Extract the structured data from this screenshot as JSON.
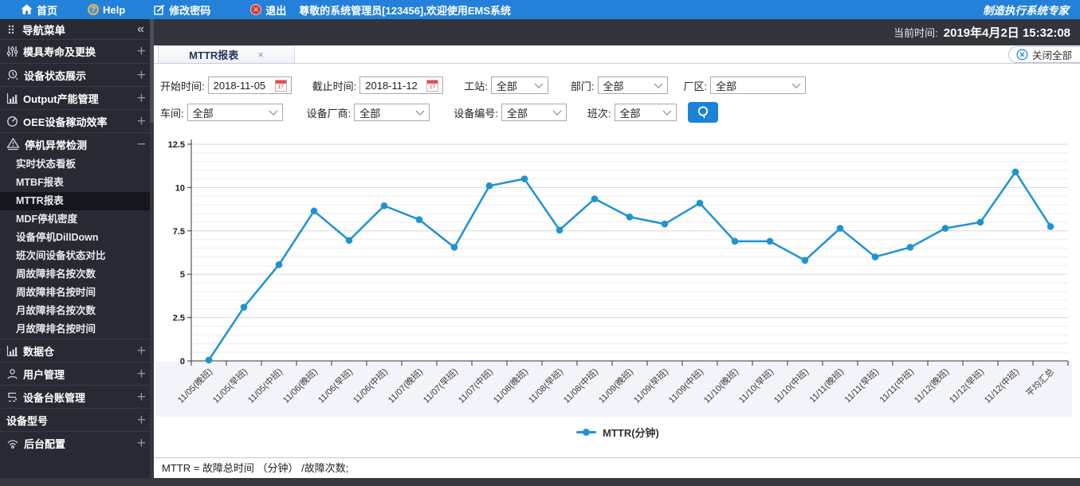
{
  "topbar": {
    "home": "首页",
    "help": "Help",
    "help_mark": "?",
    "change_password": "修改密码",
    "logout": "退出",
    "logout_mark": "✕",
    "welcome": "尊敬的系统管理员[123456],欢迎使用EMS系统",
    "brand": "制造执行系统专家"
  },
  "infobar": {
    "current_time_label": "当前时间:",
    "current_time_value": "2019年4月2日 15:32:08"
  },
  "tabs": {
    "active": "MTTR报表",
    "close_icon": "×",
    "close_all": "关闭全部"
  },
  "sidebar": {
    "title": "导航菜单",
    "collapse_icon": "«",
    "groups": [
      {
        "label": "模具寿命及更换",
        "icon": "sliders-icon",
        "state": "collapsed"
      },
      {
        "label": "设备状态展示",
        "icon": "status-icon",
        "state": "collapsed"
      },
      {
        "label": "Output产能管理",
        "icon": "barchart-icon",
        "state": "collapsed"
      },
      {
        "label": "OEE设备稼动效率",
        "icon": "gauge-icon",
        "state": "collapsed"
      },
      {
        "label": "停机异常检测",
        "icon": "warning-icon",
        "state": "expanded",
        "children": [
          "实时状态看板",
          "MTBF报表",
          "MTTR报表",
          "MDF停机密度",
          "设备停机DillDown",
          "班次间设备状态对比",
          "周故障排名按次数",
          "周故障排名按时间",
          "月故障排名按次数",
          "月故障排名按时间"
        ],
        "active_child": "MTTR报表"
      },
      {
        "label": "数据仓",
        "icon": "barchart-icon",
        "state": "collapsed"
      },
      {
        "label": "用户管理",
        "icon": "user-icon",
        "state": "collapsed"
      },
      {
        "label": "设备台账管理",
        "icon": "ledger-icon",
        "state": "collapsed"
      },
      {
        "label": "设备型号",
        "icon": "none",
        "state": "collapsed"
      },
      {
        "label": "后台配置",
        "icon": "config-icon",
        "state": "collapsed"
      }
    ]
  },
  "filters": {
    "rows": [
      [
        {
          "name": "start-date",
          "label": "开始时间:",
          "type": "date",
          "value": "2018-11-05",
          "w": 105,
          "mr": 26
        },
        {
          "name": "end-date",
          "label": "截止时间:",
          "type": "date",
          "value": "2018-11-12",
          "w": 105,
          "mr": 26
        },
        {
          "name": "station",
          "label": "工站:",
          "type": "select",
          "value": "全部",
          "w": 72,
          "mr": 28
        },
        {
          "name": "department",
          "label": "部门:",
          "type": "select",
          "value": "全部",
          "w": 88,
          "mr": 20
        },
        {
          "name": "factory",
          "label": "厂区:",
          "type": "select",
          "value": "全部",
          "w": 120,
          "mr": 0
        }
      ],
      [
        {
          "name": "workshop",
          "label": "车间:",
          "type": "select",
          "value": "全部",
          "w": 120,
          "mr": 30
        },
        {
          "name": "vendor",
          "label": "设备厂商:",
          "type": "select",
          "value": "全部",
          "w": 95,
          "mr": 30
        },
        {
          "name": "device-no",
          "label": "设备编号:",
          "type": "select",
          "value": "全部",
          "w": 82,
          "mr": 26
        },
        {
          "name": "shift",
          "label": "班次:",
          "type": "select",
          "value": "全部",
          "w": 78,
          "mr": 0
        }
      ]
    ],
    "calendar_day": "17"
  },
  "chart_data": {
    "type": "line",
    "title": "",
    "xlabel": "",
    "ylabel": "",
    "ylim": [
      0,
      12.5
    ],
    "ytick_major": 2.5,
    "ytick_minor": 0.5,
    "yticks": [
      0,
      2.5,
      5,
      7.5,
      10,
      12.5
    ],
    "grid": true,
    "legend_position": "bottom",
    "line_color": "#1f93d1",
    "categories": [
      "11/05(晚班)",
      "11/05(早班)",
      "11/05(中班)",
      "11/06(晚班)",
      "11/06(早班)",
      "11/06(中班)",
      "11/07(晚班)",
      "11/07(早班)",
      "11/07(中班)",
      "11/08(晚班)",
      "11/08(早班)",
      "11/08(中班)",
      "11/09(晚班)",
      "11/09(早班)",
      "11/09(中班)",
      "11/10(晚班)",
      "11/10(早班)",
      "11/10(中班)",
      "11/11(晚班)",
      "11/11(早班)",
      "11/11(中班)",
      "11/12(晚班)",
      "11/12(早班)",
      "11/12(中班)",
      "平均汇总"
    ],
    "series": [
      {
        "name": "MTTR(分钟)",
        "values": [
          0.05,
          3.1,
          5.55,
          8.65,
          6.95,
          8.95,
          8.15,
          6.55,
          10.1,
          10.5,
          7.55,
          9.35,
          8.3,
          7.9,
          9.1,
          6.9,
          6.9,
          5.8,
          7.65,
          6.0,
          6.55,
          7.65,
          8.0,
          10.9,
          7.75
        ]
      }
    ]
  },
  "footer": {
    "formula": "MTTR = 故障总时间 （分钟） /故障次数;"
  },
  "colors": {
    "topbar_blue": "#2381da",
    "accent_blue": "#1b82d9",
    "chart_line": "#1f93d1",
    "sidebar_bg": "#272a33",
    "infobar_bg": "#33353c",
    "logout_red": "#d43a3a",
    "help_orange": "#f2b33c"
  }
}
